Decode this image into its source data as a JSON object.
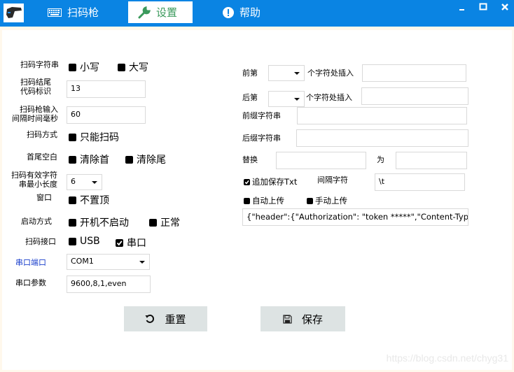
{
  "window": {
    "app_icon": "barcode-scanner-icon",
    "controls": {
      "minimize": "_",
      "maximize": "□",
      "close": "✕"
    }
  },
  "tabs": [
    {
      "label": "扫码枪",
      "icon": "keyboard-icon",
      "active": false
    },
    {
      "label": "设置",
      "icon": "wrench-icon",
      "active": true
    },
    {
      "label": "帮助",
      "icon": "info-icon",
      "active": false
    }
  ],
  "colors": {
    "titlebar": "#0a84e3",
    "active_tab_text": "#3b9a5c",
    "port_label": "#1a3fcc",
    "button_bg": "#dde3e3"
  },
  "left": {
    "case_label": "扫码字符串",
    "case_options": [
      {
        "label": "小写",
        "checked": false
      },
      {
        "label": "大写",
        "checked": false
      }
    ],
    "suffix_code_label_1": "扫码结尾",
    "suffix_code_label_2": "代码标识",
    "suffix_code_value": "13",
    "interval_label_1": "扫码枪输入",
    "interval_label_2": "间隔时间毫秒",
    "interval_value": "60",
    "mode_label": "扫码方式",
    "mode_option": {
      "label": "只能扫码",
      "checked": false
    },
    "trim_label": "首尾空白",
    "trim_options": [
      {
        "label": "清除首",
        "checked": false
      },
      {
        "label": "清除尾",
        "checked": false
      }
    ],
    "minlen_label_1": "扫码有效字符",
    "minlen_label_2": "串最小长度",
    "minlen_value": "6",
    "window_label": "窗口",
    "window_option": {
      "label": "不置顶",
      "checked": false
    },
    "startup_label": "启动方式",
    "startup_options": [
      {
        "label": "开机不启动",
        "checked": false
      },
      {
        "label": "正常",
        "checked": false
      }
    ],
    "interface_label": "扫码接口",
    "interface_options": [
      {
        "label": "USB",
        "checked": false
      },
      {
        "label": "串口",
        "checked": true
      }
    ],
    "port_label": "串口端口",
    "port_value": "COM1",
    "params_label": "串口参数",
    "params_value": "9600,8,1,even"
  },
  "right": {
    "front_label": "前第",
    "front_select": "",
    "front_insert_label": "个字符处插入",
    "front_insert_value": "",
    "back_label": "后第",
    "back_select": "",
    "back_insert_label": "个字符处插入",
    "back_insert_value": "",
    "prefix_label": "前缀字符串",
    "prefix_value": "",
    "suffix_label": "后缀字符串",
    "suffix_value": "",
    "replace_label": "替换",
    "replace_value": "",
    "replace_with_label": "为",
    "replace_with_value": "",
    "append_txt": {
      "label": "追加保存Txt",
      "checked": true
    },
    "separator_label": "间隔字符",
    "separator_value": "\\t",
    "auto_upload": {
      "label": "自动上传",
      "checked": false
    },
    "manual_upload": {
      "label": "手动上传",
      "checked": false
    },
    "upload_config_value": "{\"header\":{\"Authorization\": \"token *****\",\"Content-Type\":'a"
  },
  "buttons": {
    "reset_label": "重置",
    "save_label": "保存"
  },
  "watermark": "https://blog.csdn.net/chyg31"
}
